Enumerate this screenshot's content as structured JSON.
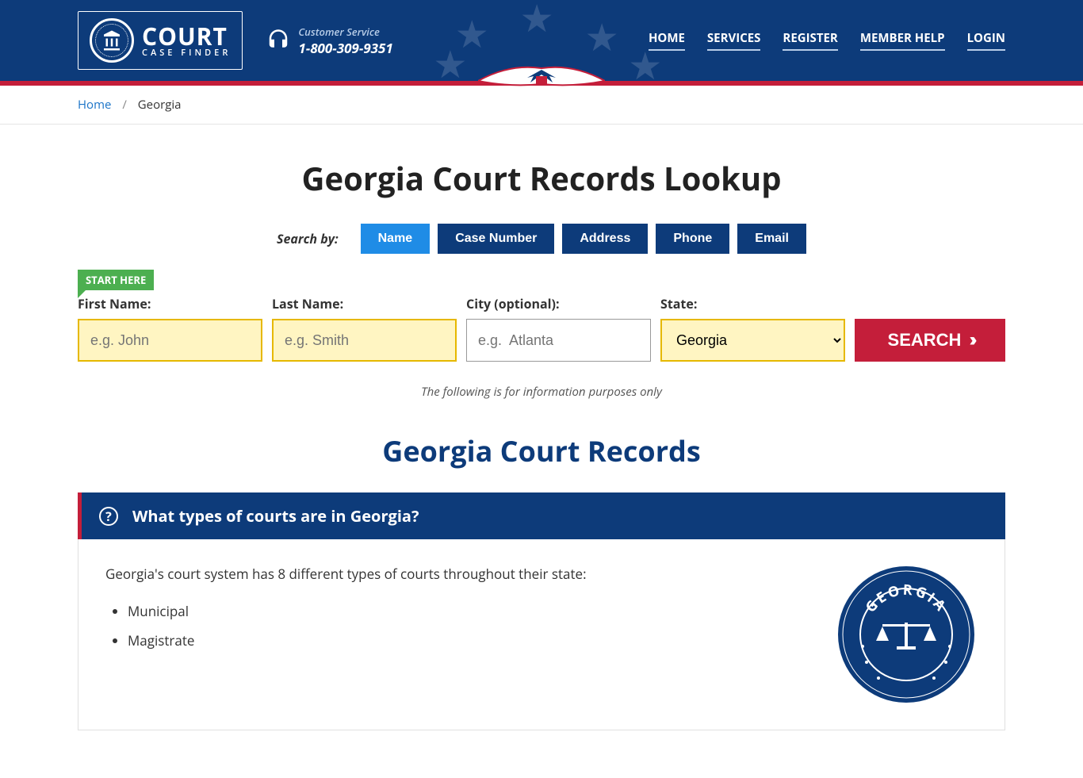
{
  "header": {
    "logo": {
      "main": "COURT",
      "sub": "CASE FINDER"
    },
    "customer_service": {
      "label": "Customer Service",
      "phone": "1-800-309-9351"
    },
    "nav": [
      "HOME",
      "SERVICES",
      "REGISTER",
      "MEMBER HELP",
      "LOGIN"
    ]
  },
  "breadcrumb": {
    "home": "Home",
    "current": "Georgia"
  },
  "page_title": "Georgia Court Records Lookup",
  "search": {
    "label": "Search by:",
    "tabs": [
      "Name",
      "Case Number",
      "Address",
      "Phone",
      "Email"
    ],
    "start_here": "START HERE",
    "fields": {
      "first_name": {
        "label": "First Name:",
        "placeholder": "e.g. John"
      },
      "last_name": {
        "label": "Last Name:",
        "placeholder": "e.g. Smith"
      },
      "city": {
        "label": "City (optional):",
        "placeholder": "e.g.  Atlanta"
      },
      "state": {
        "label": "State:",
        "value": "Georgia"
      }
    },
    "button": "SEARCH"
  },
  "disclaimer": "The following is for information purposes only",
  "section_title": "Georgia Court Records",
  "question": "What types of courts are in Georgia?",
  "content_intro": "Georgia's court system has 8 different types of courts throughout their state:",
  "court_types": [
    "Municipal",
    "Magistrate"
  ],
  "seal_text": "GEORGIA"
}
